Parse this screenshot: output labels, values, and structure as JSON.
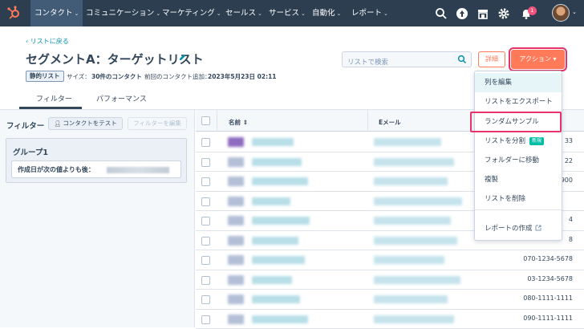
{
  "nav": {
    "items": [
      {
        "label": "コンタクト",
        "active": true
      },
      {
        "label": "コミュニケーション"
      },
      {
        "label": "マーケティング"
      },
      {
        "label": "セールス"
      },
      {
        "label": "サービス"
      },
      {
        "label": "自動化"
      },
      {
        "label": "レポート"
      }
    ],
    "chevron": "⌄",
    "notification_count": "1",
    "icons": [
      "hubspot-logo-icon",
      "search-icon",
      "upgrade-icon",
      "marketplace-icon",
      "gear-icon",
      "bell-icon"
    ]
  },
  "header": {
    "back_link": "‹ リストに戻る",
    "title": "セグメントA：ターゲットリスト",
    "static_badge": "静的リスト",
    "size_label": "サイズ：",
    "size_value": "30件のコンタクト",
    "last_added_label": "前回のコンタクト追加：",
    "last_added_value": "2023年5月23日 02:11",
    "search_placeholder": "リストで検索",
    "details_button": "詳細",
    "action_button": "アクション ▾"
  },
  "tabs": [
    {
      "label": "フィルター",
      "active": true
    },
    {
      "label": "パフォーマンス"
    }
  ],
  "filters": {
    "label": "フィルター",
    "test_button": "コンタクトをテスト",
    "edit_button": "フィルターを編集",
    "group_title": "グループ1",
    "rule_text": "作成日が次の値よりも後："
  },
  "table": {
    "columns": [
      "名前 ⇕",
      "Eメール"
    ],
    "rows": [
      {
        "phone": "33"
      },
      {
        "phone": "22"
      },
      {
        "phone": "900"
      },
      {
        "phone": ""
      },
      {
        "phone": "4"
      },
      {
        "phone": "8"
      },
      {
        "phone": "070-1234-5678"
      },
      {
        "phone": "03-1234-5678"
      },
      {
        "phone": "080-1111-1111"
      },
      {
        "phone": "090-1111-1111"
      }
    ]
  },
  "action_menu": {
    "items": [
      {
        "label": "列を編集",
        "hover": true
      },
      {
        "label": "リストをエクスポート"
      },
      {
        "label": "ランダムサンプル",
        "highlighted": true
      },
      {
        "label": "リストを分割",
        "badge": "新規"
      },
      {
        "label": "フォルダーに移動"
      },
      {
        "label": "複製"
      },
      {
        "label": "リストを削除"
      },
      {
        "label": "レポートの作成"
      }
    ]
  },
  "colors": {
    "nav_bg": "#2d3e50",
    "accent": "#ff7a59",
    "highlight": "#e5336b",
    "link": "#0091ae",
    "new_badge": "#00bda5"
  }
}
